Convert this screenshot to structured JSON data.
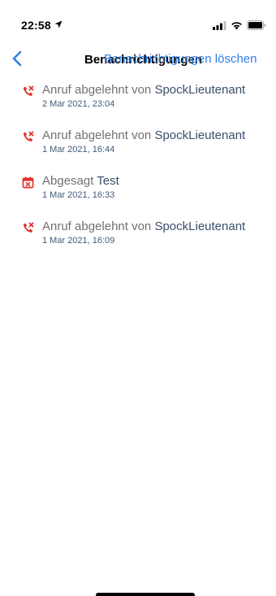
{
  "status_bar": {
    "time": "22:58",
    "icons": [
      "location-arrow-icon",
      "signal-icon",
      "wifi-icon",
      "battery-icon"
    ]
  },
  "nav": {
    "back_icon": "chevron-left-icon",
    "title": "Benachrichtigungen",
    "action_label": "Benachrichtigungen löschen"
  },
  "notifications": [
    {
      "icon": "missed-call-icon",
      "title_prefix": "Anruf abgelehnt von",
      "title_subject": "SpockLieutenant",
      "timestamp": "2 Mar 2021, 23:04"
    },
    {
      "icon": "missed-call-icon",
      "title_prefix": "Anruf abgelehnt von",
      "title_subject": "SpockLieutenant",
      "timestamp": "1 Mar 2021, 16:44"
    },
    {
      "icon": "calendar-cancel-icon",
      "title_prefix": "Abgesagt",
      "title_subject": "Test",
      "timestamp": "1 Mar 2021, 16:33"
    },
    {
      "icon": "missed-call-icon",
      "title_prefix": "Anruf abgelehnt von",
      "title_subject": "SpockLieutenant",
      "timestamp": "1 Mar 2021, 16:09"
    }
  ],
  "colors": {
    "accent": "#2f7fe6",
    "icon_red": "#e0322e",
    "subject_text": "#3a4f6a",
    "timestamp_text": "#3f5a7a"
  }
}
